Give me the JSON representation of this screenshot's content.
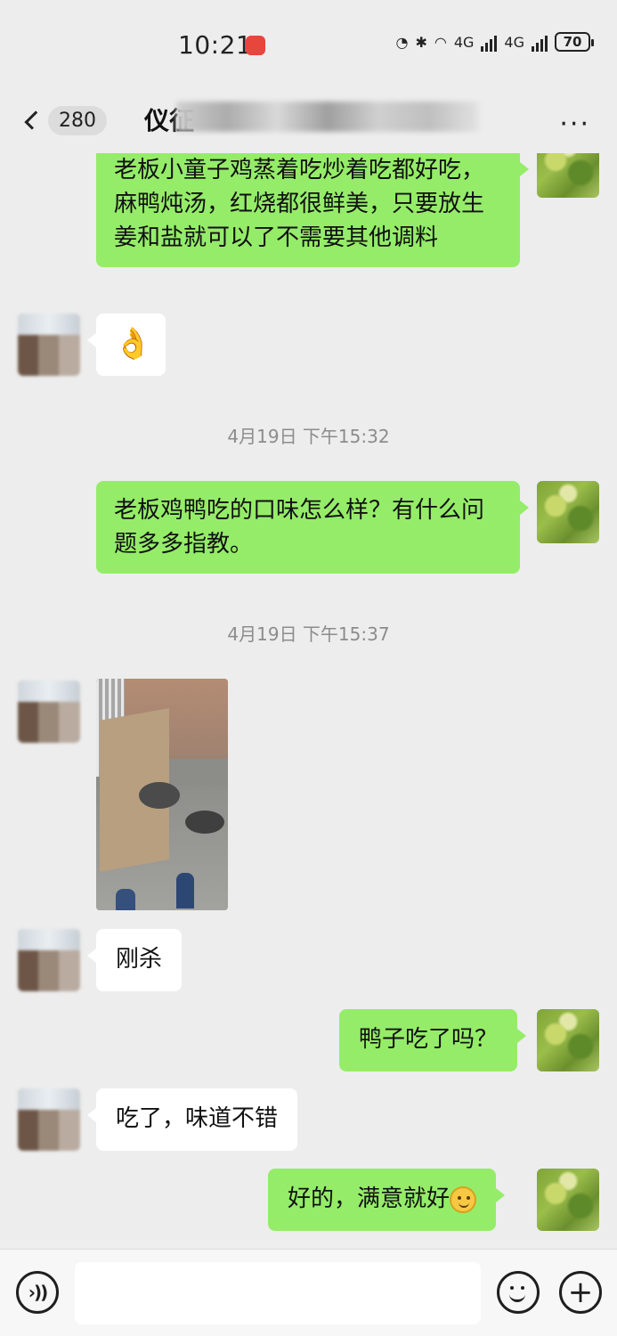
{
  "status_bar": {
    "time": "10:21",
    "network_a": "4G",
    "network_b": "4G",
    "battery": "70"
  },
  "header": {
    "unread_count": "280",
    "title": "仪征",
    "more": "···"
  },
  "messages": [
    {
      "side": "me",
      "text": "老板小童子鸡蒸着吃炒着吃都好吃，麻鸭炖汤，红烧都很鲜美，只要放生姜和盐就可以了不需要其他调料"
    },
    {
      "side": "other",
      "emoji": "👌"
    },
    {
      "timestamp": "4月19日 下午15:32"
    },
    {
      "side": "me",
      "text": "老板鸡鸭吃的口味怎么样？有什么问题多多指教。"
    },
    {
      "timestamp": "4月19日 下午15:37"
    },
    {
      "side": "other",
      "type": "image"
    },
    {
      "side": "other",
      "text": "刚杀"
    },
    {
      "side": "me",
      "text": "鸭子吃了吗？"
    },
    {
      "side": "other",
      "text": "吃了，味道不错"
    },
    {
      "side": "me",
      "text": "好的，满意就好",
      "emoji_icon": "smile-emoji-icon"
    }
  ],
  "input_bar": {
    "placeholder": ""
  }
}
